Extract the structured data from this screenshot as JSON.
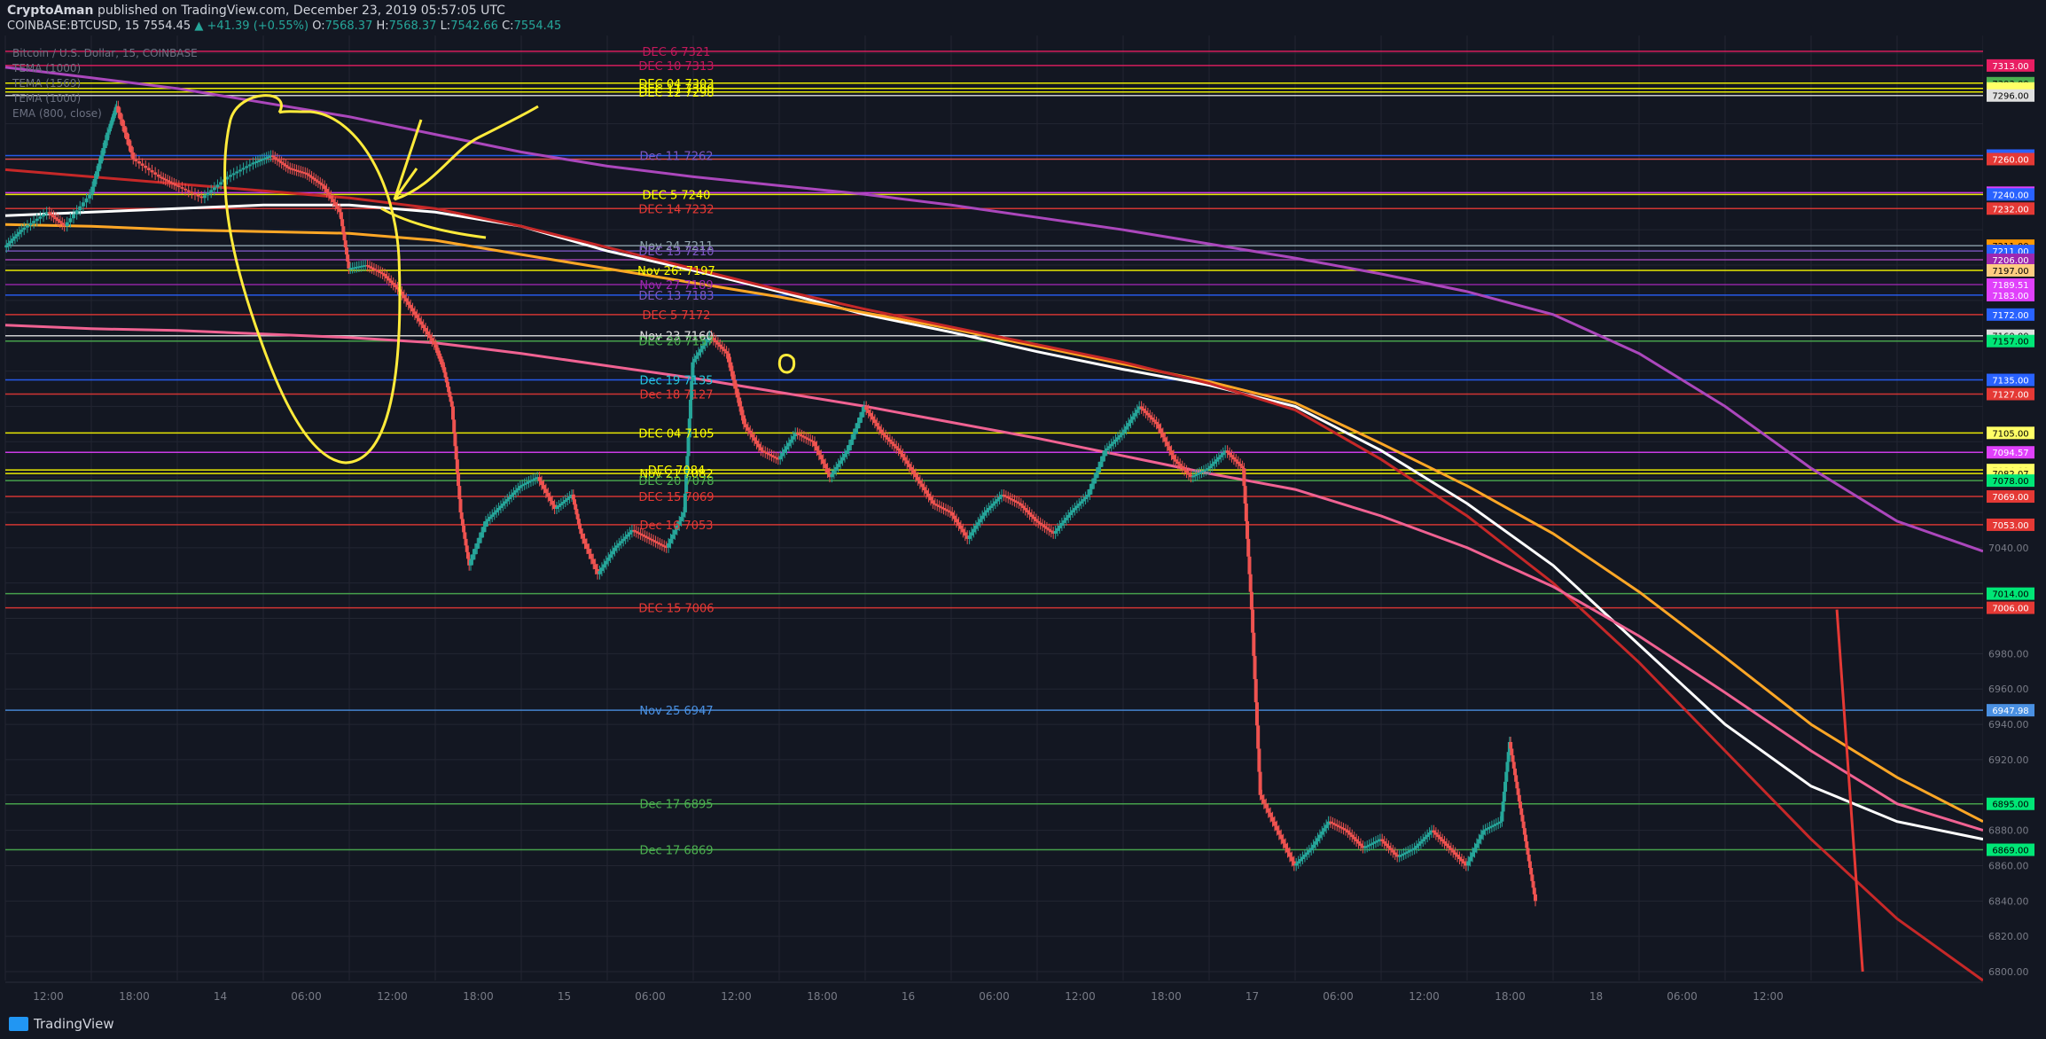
{
  "header": {
    "author": "CryptoAman",
    "published": "published on TradingView.com, December 23, 2019 05:57:05 UTC",
    "symbol": "COINBASE:BTCUSD, 15",
    "last": "7554.45",
    "change": "▲ +41.39 (+0.55%)",
    "o_label": "O:",
    "o": "7568.37",
    "h_label": "H:",
    "h": "7568.37",
    "l_label": "L:",
    "l": "7542.66",
    "c_label": "C:",
    "c": "7554.45"
  },
  "legend": [
    "Bitcoin / U.S. Dollar, 15, COINBASE",
    "TEMA (1000)",
    "TEMA (1569)",
    "TEMA (1000)",
    "EMA (800, close)"
  ],
  "footer": {
    "brand": "TradingView"
  },
  "colors": {
    "bg": "#131722",
    "grid": "#232632",
    "up": "#26a69a",
    "down": "#ef5350",
    "annotation": "#ffeb3b"
  },
  "chart_data": {
    "type": "candlestick",
    "ylim": [
      6795,
      7330
    ],
    "x_ticks": [
      "12:00",
      "18:00",
      "14",
      "06:00",
      "12:00",
      "18:00",
      "15",
      "06:00",
      "12:00",
      "18:00",
      "16",
      "06:00",
      "12:00",
      "18:00",
      "17",
      "06:00",
      "12:00",
      "18:00",
      "18",
      "06:00",
      "12:00"
    ],
    "y_ticks": [
      7040,
      6980,
      6960,
      6940,
      6920,
      6880,
      6860,
      6840,
      6820,
      6800
    ],
    "levels": [
      {
        "price": 7321,
        "text": "DEC 6 7321",
        "color": "#e91e63",
        "label_color": "#c2185b"
      },
      {
        "price": 7313,
        "text": "DEC 10 7313",
        "color": "#e91e63",
        "label_color": "#c2185b",
        "badge": "7313.00",
        "badge_bg": "#e91e63"
      },
      {
        "price": 7303,
        "text": "DEC 04 7303",
        "color": "#ffff00",
        "label_color": "#ffff00",
        "badge": "7303.00",
        "badge_bg": "#4caf50"
      },
      {
        "price": 7300,
        "text": "DEC 11 7300",
        "color": "#ffff00",
        "label_color": "#ffff00",
        "badge": "7303.00",
        "badge_bg": "#ffff66"
      },
      {
        "price": 7298,
        "text": "DEC 12 7298",
        "color": "#ffff00",
        "label_color": "#ffff00",
        "badge": "7298.00",
        "badge_bg": "#ffff66"
      },
      {
        "price": 7296,
        "text": "",
        "color": "#e0e0e0",
        "label_color": "#e0e0e0",
        "badge": "7296.00",
        "badge_bg": "#e0e0e0"
      },
      {
        "price": 7262,
        "text": "Dec 11 7262",
        "color": "#2962ff",
        "label_color": "#7e57c2",
        "badge": "7262.00",
        "badge_bg": "#2962ff"
      },
      {
        "price": 7260,
        "text": "",
        "color": "#ef5350",
        "label_color": "#ef5350",
        "badge": "7260.00",
        "badge_bg": "#e53935"
      },
      {
        "price": 7241,
        "text": "",
        "color": "#e040fb",
        "label_color": "#e040fb",
        "badge": "7241.00",
        "badge_bg": "#e040fb"
      },
      {
        "price": 7240,
        "text": "DEC 5 7240",
        "color": "#ffff00",
        "label_color": "#ffff00",
        "badge": "7240.00",
        "badge_bg": "#2962ff"
      },
      {
        "price": 7232,
        "text": "DEC 14 7232",
        "color": "#e53935",
        "label_color": "#e53935",
        "badge": "7232.00",
        "badge_bg": "#e53935"
      },
      {
        "price": 7211,
        "text": "Nov 24 7211",
        "color": "#90a4ae",
        "label_color": "#90a4ae",
        "badge": "7211.00",
        "badge_bg": "#ff9800"
      },
      {
        "price": 7208,
        "text": "DEC 13 7210",
        "color": "#7e57c2",
        "label_color": "#7e57c2",
        "badge": "7211.00",
        "badge_bg": "#2962ff"
      },
      {
        "price": 7203,
        "text": "",
        "color": "#ab47bc",
        "label_color": "#ab47bc",
        "badge": "7206.00",
        "badge_bg": "#9c27b0"
      },
      {
        "price": 7197,
        "text": "Nov 26: 7197",
        "color": "#ffff00",
        "label_color": "#ffff00",
        "badge": "7197.00",
        "badge_bg": "#ffcc80"
      },
      {
        "price": 7189,
        "text": "Nov 27 7189",
        "color": "#9c27b0",
        "label_color": "#9c27b0",
        "badge": "7189.51",
        "badge_bg": "#e040fb"
      },
      {
        "price": 7183,
        "text": "DEC 13 7183",
        "color": "#2962ff",
        "label_color": "#7e57c2",
        "badge": "7183.00",
        "badge_bg": "#e040fb"
      },
      {
        "price": 7172,
        "text": "DEC 5 7172",
        "color": "#e53935",
        "label_color": "#e53935",
        "badge": "7172.00",
        "badge_bg": "#2962ff"
      },
      {
        "price": 7160,
        "text": "Nov 23 7160",
        "color": "#e0e0e0",
        "label_color": "#e0e0e0",
        "badge": "7160.00",
        "badge_bg": "#e0e0e0"
      },
      {
        "price": 7157,
        "text": "DEC 20 7157",
        "color": "#4caf50",
        "label_color": "#4caf50",
        "badge": "7157.00",
        "badge_bg": "#00e676"
      },
      {
        "price": 7135,
        "text": "Dec 19 7135",
        "color": "#2962ff",
        "label_color": "#26c6da",
        "badge": "7135.00",
        "badge_bg": "#2962ff"
      },
      {
        "price": 7127,
        "text": "Dec 18 7127",
        "color": "#e53935",
        "label_color": "#e53935",
        "badge": "7127.00",
        "badge_bg": "#e53935"
      },
      {
        "price": 7105,
        "text": "DEC 04 7105",
        "color": "#ffff00",
        "label_color": "#ffff00",
        "badge": "7105.00",
        "badge_bg": "#ffff66"
      },
      {
        "price": 7094,
        "text": "",
        "color": "#e040fb",
        "label_color": "#e040fb",
        "badge": "7094.57",
        "badge_bg": "#e040fb"
      },
      {
        "price": 7084,
        "text": "DEC 7084",
        "color": "#ffff00",
        "label_color": "#ffff00",
        "badge": "7084.00",
        "badge_bg": "#ffff66"
      },
      {
        "price": 7082,
        "text": "Nov 21 7082",
        "color": "#ffff00",
        "label_color": "#ffff00",
        "badge": "7082.07",
        "badge_bg": "#ffff66"
      },
      {
        "price": 7078,
        "text": "DEC 20 7078",
        "color": "#4caf50",
        "label_color": "#4caf50",
        "badge": "7078.00",
        "badge_bg": "#00e676"
      },
      {
        "price": 7069,
        "text": "DEC 15 7069",
        "color": "#e53935",
        "label_color": "#e53935",
        "badge": "7069.00",
        "badge_bg": "#e53935"
      },
      {
        "price": 7053,
        "text": "Dec 16 7053",
        "color": "#e53935",
        "label_color": "#e53935",
        "badge": "7053.00",
        "badge_bg": "#e53935"
      },
      {
        "price": 7014,
        "text": "",
        "color": "#4caf50",
        "label_color": "#4caf50",
        "badge": "7014.00",
        "badge_bg": "#00e676"
      },
      {
        "price": 7006,
        "text": "DEC 15 7006",
        "color": "#e53935",
        "label_color": "#e53935",
        "badge": "7006.00",
        "badge_bg": "#e53935"
      },
      {
        "price": 6948,
        "text": "Nov 25 6947",
        "color": "#4a90e2",
        "label_color": "#4a90e2",
        "badge": "6947.98",
        "badge_bg": "#4a90e2"
      },
      {
        "price": 6895,
        "text": "Dec 17 6895",
        "color": "#4caf50",
        "label_color": "#4caf50",
        "badge": "6895.00",
        "badge_bg": "#00e676"
      },
      {
        "price": 6869,
        "text": "Dec 17 6869",
        "color": "#4caf50",
        "label_color": "#4caf50",
        "badge": "6869.00",
        "badge_bg": "#00e676"
      }
    ],
    "series": [
      {
        "color": "#ffffff",
        "points": [
          [
            0,
            7228
          ],
          [
            1,
            7230
          ],
          [
            2,
            7232
          ],
          [
            3,
            7234
          ],
          [
            4,
            7234
          ],
          [
            5,
            7230
          ],
          [
            6,
            7222
          ],
          [
            7,
            7208
          ],
          [
            8,
            7197
          ],
          [
            9,
            7185
          ],
          [
            10,
            7172
          ],
          [
            11,
            7162
          ],
          [
            12,
            7151
          ],
          [
            13,
            7141
          ],
          [
            14,
            7132
          ],
          [
            15,
            7120
          ],
          [
            16,
            7095
          ],
          [
            17,
            7065
          ],
          [
            18,
            7030
          ],
          [
            19,
            6985
          ],
          [
            20,
            6940
          ],
          [
            21,
            6905
          ],
          [
            22,
            6885
          ],
          [
            23,
            6875
          ]
        ]
      },
      {
        "color": "#ffa726",
        "points": [
          [
            0,
            7223
          ],
          [
            1,
            7222
          ],
          [
            2,
            7220
          ],
          [
            3,
            7219
          ],
          [
            4,
            7218
          ],
          [
            5,
            7214
          ],
          [
            6,
            7206
          ],
          [
            7,
            7198
          ],
          [
            8,
            7190
          ],
          [
            9,
            7182
          ],
          [
            10,
            7173
          ],
          [
            11,
            7164
          ],
          [
            12,
            7154
          ],
          [
            13,
            7144
          ],
          [
            14,
            7134
          ],
          [
            15,
            7122
          ],
          [
            16,
            7099
          ],
          [
            17,
            7075
          ],
          [
            18,
            7048
          ],
          [
            19,
            7015
          ],
          [
            20,
            6978
          ],
          [
            21,
            6940
          ],
          [
            22,
            6910
          ],
          [
            23,
            6885
          ]
        ]
      },
      {
        "color": "#c62828",
        "points": [
          [
            0,
            7254
          ],
          [
            1,
            7250
          ],
          [
            2,
            7246
          ],
          [
            3,
            7242
          ],
          [
            4,
            7238
          ],
          [
            5,
            7232
          ],
          [
            6,
            7222
          ],
          [
            7,
            7210
          ],
          [
            8,
            7198
          ],
          [
            9,
            7186
          ],
          [
            10,
            7175
          ],
          [
            11,
            7165
          ],
          [
            12,
            7155
          ],
          [
            13,
            7145
          ],
          [
            14,
            7133
          ],
          [
            15,
            7118
          ],
          [
            16,
            7090
          ],
          [
            17,
            7058
          ],
          [
            18,
            7020
          ],
          [
            19,
            6975
          ],
          [
            20,
            6925
          ],
          [
            21,
            6875
          ],
          [
            22,
            6830
          ],
          [
            23,
            6795
          ]
        ]
      },
      {
        "color": "#f06292",
        "points": [
          [
            0,
            7166
          ],
          [
            1,
            7164
          ],
          [
            2,
            7163
          ],
          [
            3,
            7161
          ],
          [
            4,
            7159
          ],
          [
            5,
            7156
          ],
          [
            6,
            7150
          ],
          [
            7,
            7143
          ],
          [
            8,
            7136
          ],
          [
            9,
            7128
          ],
          [
            10,
            7120
          ],
          [
            11,
            7111
          ],
          [
            12,
            7102
          ],
          [
            13,
            7092
          ],
          [
            14,
            7082
          ],
          [
            15,
            7073
          ],
          [
            16,
            7058
          ],
          [
            17,
            7040
          ],
          [
            18,
            7018
          ],
          [
            19,
            6990
          ],
          [
            20,
            6958
          ],
          [
            21,
            6925
          ],
          [
            22,
            6895
          ],
          [
            23,
            6880
          ]
        ]
      },
      {
        "color": "#ab47bc",
        "points": [
          [
            0,
            7312
          ],
          [
            1,
            7306
          ],
          [
            2,
            7300
          ],
          [
            3,
            7292
          ],
          [
            4,
            7284
          ],
          [
            5,
            7274
          ],
          [
            6,
            7264
          ],
          [
            7,
            7256
          ],
          [
            8,
            7250
          ],
          [
            9,
            7245
          ],
          [
            10,
            7240
          ],
          [
            11,
            7234
          ],
          [
            12,
            7227
          ],
          [
            13,
            7220
          ],
          [
            14,
            7212
          ],
          [
            15,
            7204
          ],
          [
            16,
            7195
          ],
          [
            17,
            7185
          ],
          [
            18,
            7172
          ],
          [
            19,
            7150
          ],
          [
            20,
            7120
          ],
          [
            21,
            7085
          ],
          [
            22,
            7055
          ],
          [
            23,
            7038
          ]
        ]
      },
      {
        "color": "#e53935",
        "points": [
          [
            21.3,
            7005
          ],
          [
            21.6,
            6800
          ]
        ]
      }
    ],
    "price_path": [
      [
        0,
        7210
      ],
      [
        0.2,
        7220
      ],
      [
        0.5,
        7230
      ],
      [
        0.7,
        7222
      ],
      [
        1.0,
        7240
      ],
      [
        1.2,
        7275
      ],
      [
        1.3,
        7290
      ],
      [
        1.5,
        7260
      ],
      [
        1.8,
        7250
      ],
      [
        2.0,
        7245
      ],
      [
        2.3,
        7238
      ],
      [
        2.6,
        7250
      ],
      [
        2.9,
        7258
      ],
      [
        3.1,
        7262
      ],
      [
        3.3,
        7255
      ],
      [
        3.5,
        7252
      ],
      [
        3.7,
        7245
      ],
      [
        3.9,
        7230
      ],
      [
        4.0,
        7198
      ],
      [
        4.2,
        7200
      ],
      [
        4.4,
        7195
      ],
      [
        4.6,
        7185
      ],
      [
        4.8,
        7170
      ],
      [
        5.0,
        7155
      ],
      [
        5.1,
        7142
      ],
      [
        5.2,
        7120
      ],
      [
        5.3,
        7060
      ],
      [
        5.4,
        7030
      ],
      [
        5.6,
        7055
      ],
      [
        5.8,
        7065
      ],
      [
        6.0,
        7075
      ],
      [
        6.2,
        7080
      ],
      [
        6.4,
        7062
      ],
      [
        6.6,
        7070
      ],
      [
        6.7,
        7048
      ],
      [
        6.9,
        7025
      ],
      [
        7.1,
        7040
      ],
      [
        7.3,
        7050
      ],
      [
        7.5,
        7045
      ],
      [
        7.7,
        7040
      ],
      [
        7.9,
        7060
      ],
      [
        8.0,
        7145
      ],
      [
        8.2,
        7160
      ],
      [
        8.4,
        7150
      ],
      [
        8.6,
        7110
      ],
      [
        8.8,
        7095
      ],
      [
        9.0,
        7090
      ],
      [
        9.2,
        7105
      ],
      [
        9.4,
        7100
      ],
      [
        9.6,
        7080
      ],
      [
        9.8,
        7095
      ],
      [
        10.0,
        7120
      ],
      [
        10.2,
        7105
      ],
      [
        10.4,
        7095
      ],
      [
        10.6,
        7080
      ],
      [
        10.8,
        7065
      ],
      [
        11.0,
        7060
      ],
      [
        11.2,
        7045
      ],
      [
        11.4,
        7060
      ],
      [
        11.6,
        7070
      ],
      [
        11.8,
        7065
      ],
      [
        12.0,
        7055
      ],
      [
        12.2,
        7048
      ],
      [
        12.4,
        7060
      ],
      [
        12.6,
        7070
      ],
      [
        12.8,
        7095
      ],
      [
        13.0,
        7105
      ],
      [
        13.2,
        7120
      ],
      [
        13.4,
        7110
      ],
      [
        13.6,
        7090
      ],
      [
        13.8,
        7080
      ],
      [
        14.0,
        7085
      ],
      [
        14.2,
        7095
      ],
      [
        14.4,
        7085
      ],
      [
        14.5,
        7005
      ],
      [
        14.6,
        6900
      ],
      [
        14.8,
        6880
      ],
      [
        15.0,
        6860
      ],
      [
        15.2,
        6870
      ],
      [
        15.4,
        6885
      ],
      [
        15.6,
        6880
      ],
      [
        15.8,
        6870
      ],
      [
        16.0,
        6875
      ],
      [
        16.2,
        6865
      ],
      [
        16.4,
        6870
      ],
      [
        16.6,
        6880
      ],
      [
        16.8,
        6870
      ],
      [
        17.0,
        6860
      ],
      [
        17.2,
        6880
      ],
      [
        17.4,
        6885
      ],
      [
        17.5,
        6930
      ],
      [
        17.6,
        6900
      ],
      [
        17.7,
        6870
      ],
      [
        17.8,
        6840
      ]
    ]
  }
}
